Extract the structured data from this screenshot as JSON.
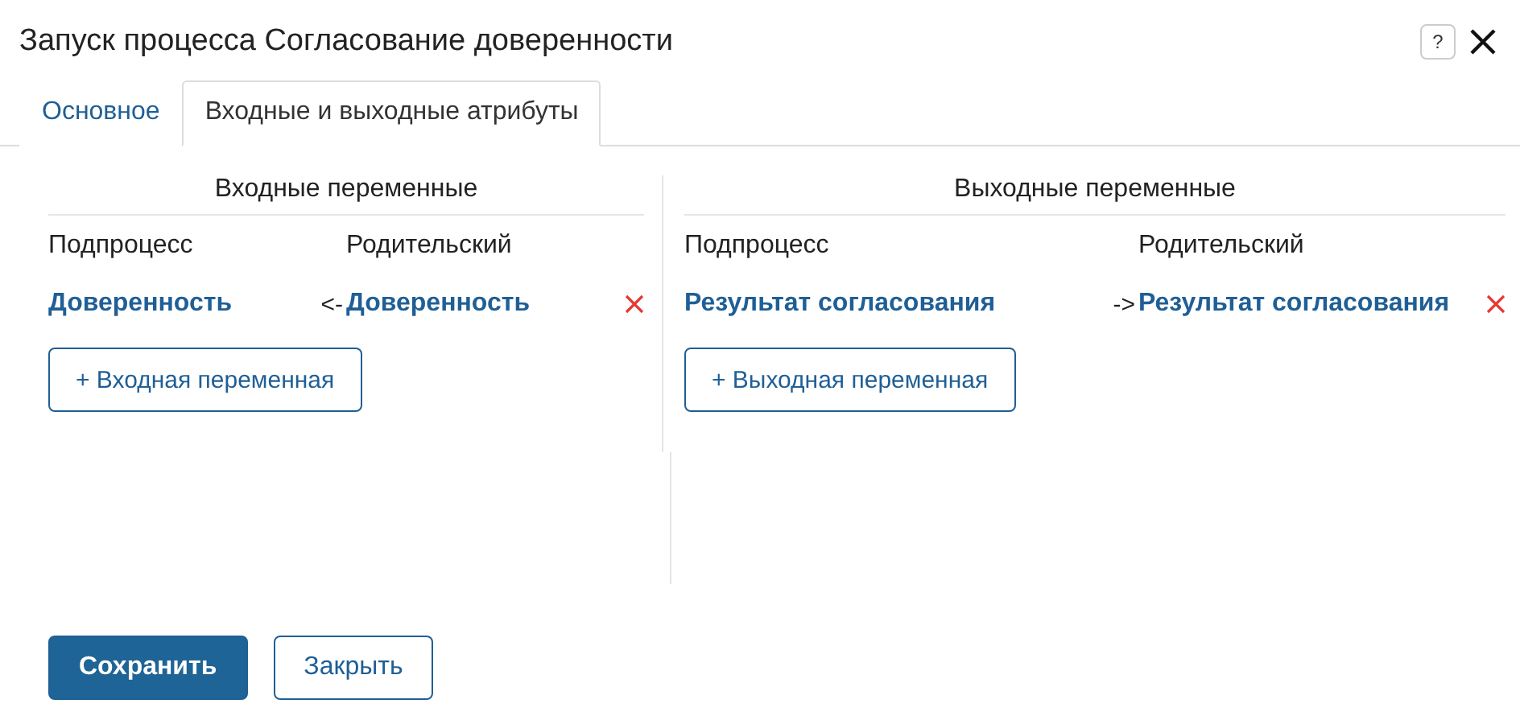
{
  "window": {
    "title": "Запуск процесса Согласование доверенности",
    "help": "?"
  },
  "tabs": [
    {
      "label": "Основное",
      "selected": false
    },
    {
      "label": "Входные и выходные атрибуты",
      "selected": true
    }
  ],
  "panels": [
    {
      "title": "Входные переменные",
      "columns": [
        "Подпроцесс",
        "Родительский"
      ],
      "rows": [
        {
          "subprocess": "Доверенность",
          "arrow": "<-",
          "parent": "Доверенность"
        }
      ],
      "add_button": "+ Входная переменная"
    },
    {
      "title": "Выходные переменные",
      "columns": [
        "Подпроцесс",
        "Родительский"
      ],
      "rows": [
        {
          "subprocess": "Результат согласования",
          "arrow": "->",
          "parent": "Результат согласования"
        }
      ],
      "add_button": "+ Выходная переменная"
    }
  ],
  "buttons": [
    {
      "label": "Сохранить",
      "kind": "primary"
    },
    {
      "label": "Закрыть",
      "kind": "secondary"
    }
  ]
}
